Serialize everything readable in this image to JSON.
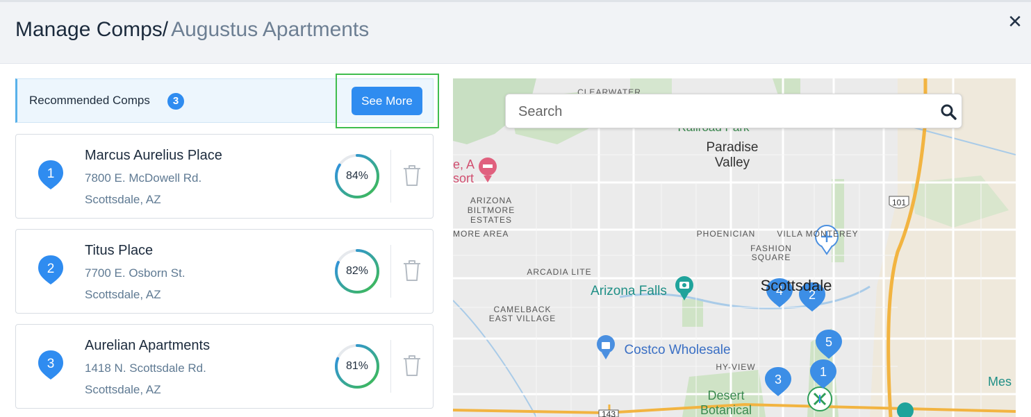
{
  "header": {
    "title_prefix": "Manage Comps/",
    "title_property": "Augustus Apartments",
    "close_glyph": "✕"
  },
  "recommended": {
    "label": "Recommended Comps",
    "count": "3",
    "see_more_label": "See More"
  },
  "comps": [
    {
      "rank": "1",
      "name": "Marcus Aurelius Place",
      "address_line1": "7800 E. McDowell Rd.",
      "address_line2": "Scottsdale, AZ",
      "score_label": "84%",
      "score": 0.84
    },
    {
      "rank": "2",
      "name": "Titus Place",
      "address_line1": "7700 E. Osborn St.",
      "address_line2": "Scottsdale, AZ",
      "score_label": "82%",
      "score": 0.82
    },
    {
      "rank": "3",
      "name": "Aurelian Apartments",
      "address_line1": "1418 N. Scottsdale Rd.",
      "address_line2": "Scottsdale, AZ",
      "score_label": "81%",
      "score": 0.81
    }
  ],
  "map": {
    "search_placeholder": "Search",
    "labels": {
      "clearwater": "CLEARWATER",
      "railroad_park": "Railroad Park",
      "paradise": "Paradise",
      "valley": "Valley",
      "resort_a": "e, A",
      "resort_b": "sort",
      "arizona": "ARIZONA",
      "biltmore": "BILTMORE",
      "estates": "ESTATES",
      "more_area": "MORE AREA",
      "phoenician": "PHOENICIAN",
      "villa_monterey": "VILLA MONTEREY",
      "fashion": "FASHION",
      "square": "SQUARE",
      "arcadia_lite": "ARCADIA LITE",
      "arizona_falls": "Arizona Falls",
      "scottsdale": "Scottsdale",
      "camelback": "CAMELBACK",
      "east_village": "EAST VILLAGE",
      "costco": "Costco Wholesale",
      "hy_view": "HY-VIEW",
      "desert": "Desert",
      "botanical": "Botanical",
      "mes": "Mes",
      "hwy101": "101",
      "hwy143": "143"
    },
    "markers": [
      "1",
      "2",
      "3",
      "4",
      "5"
    ]
  },
  "colors": {
    "accent": "#2f8cf0",
    "ring_green": "#3fbd4d",
    "ring_blue": "#2f8cf0",
    "highlight": "#3fbd4d"
  }
}
